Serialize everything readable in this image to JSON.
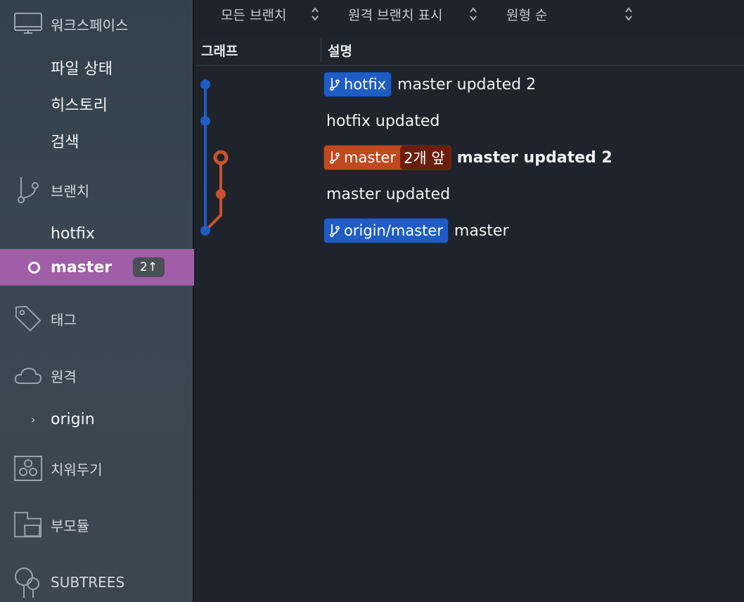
{
  "sidebar": {
    "workspace": {
      "label": "워크스페이스",
      "icon": "monitor-icon"
    },
    "workspace_items": [
      "파일 상태",
      "히스토리",
      "검색"
    ],
    "branches": {
      "label": "브랜치",
      "icon": "branch-icon"
    },
    "branch_items": [
      {
        "label": "hotfix"
      },
      {
        "label": "master",
        "ahead": "2↑",
        "active": true
      }
    ],
    "tags": {
      "label": "태그",
      "icon": "tag-icon"
    },
    "remotes": {
      "label": "원격",
      "icon": "cloud-icon"
    },
    "remote_items": [
      {
        "label": "origin"
      }
    ],
    "stashes": {
      "label": "치워두기",
      "icon": "stash-icon"
    },
    "submodules": {
      "label": "부모듈",
      "icon": "submodule-icon"
    },
    "subtrees": {
      "label": "SUBTREES",
      "icon": "subtree-icon"
    }
  },
  "toolbar": {
    "branch_filter": "모든 브랜치",
    "remote_filter": "원격 브랜치 표시",
    "order": "원형 순"
  },
  "table": {
    "col_graph": "그래프",
    "col_desc": "설명"
  },
  "commits": [
    {
      "refs": [
        {
          "name": "hotfix",
          "color": "#1f5cc4"
        }
      ],
      "message": "master updated 2"
    },
    {
      "refs": [],
      "message": "hotfix updated"
    },
    {
      "refs": [
        {
          "name": "master",
          "color": "#c1481f",
          "ahead": "2개 앞"
        }
      ],
      "message": "master updated 2",
      "head": true
    },
    {
      "refs": [],
      "message": "master updated"
    },
    {
      "refs": [
        {
          "name": "origin/master",
          "color": "#1f5cc4"
        }
      ],
      "message": "master"
    }
  ],
  "colors": {
    "blue_lane": "#1f5cc4",
    "orange_lane": "#c9532a",
    "active_branch_bg": "#a05ea8"
  }
}
